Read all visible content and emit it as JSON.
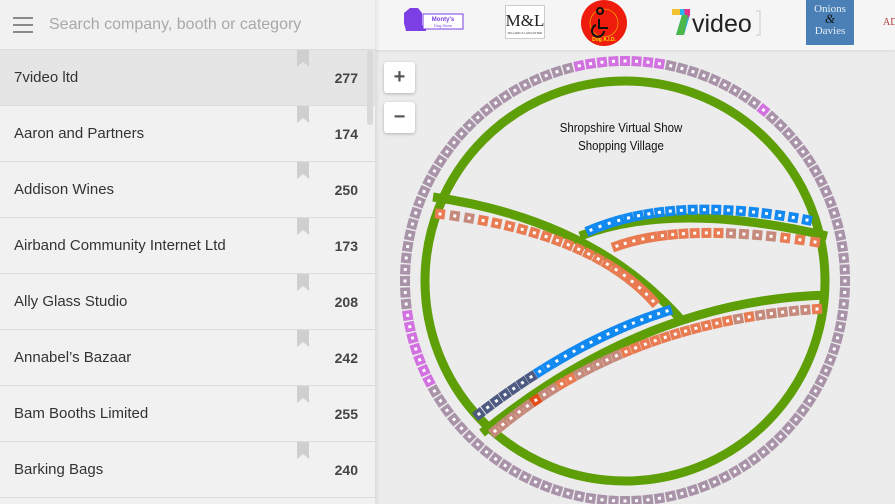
{
  "search": {
    "placeholder": "Search company, booth or category",
    "value": ""
  },
  "exhibitors": [
    {
      "name": "7video ltd",
      "booth": "277",
      "active": true
    },
    {
      "name": "Aaron and Partners",
      "booth": "174"
    },
    {
      "name": "Addison Wines",
      "booth": "250"
    },
    {
      "name": "Airband Community Internet Ltd",
      "booth": "173"
    },
    {
      "name": "Ally Glass Studio",
      "booth": "208"
    },
    {
      "name": "Annabel’s Bazaar",
      "booth": "242"
    },
    {
      "name": "Bam Booths Limited",
      "booth": "255"
    },
    {
      "name": "Barking Bags",
      "booth": "240"
    }
  ],
  "sponsors": [
    {
      "name": "Monty's Dog Store",
      "line1": "Monty's",
      "line2": "Dog Store"
    },
    {
      "name": "Millard & Lancaster",
      "line1": "M&L",
      "line2": "MILLARD & LANCASTER"
    },
    {
      "name": "Assistance In Disability Dog A.I.D.",
      "line1": "Assistance In Disability",
      "line2": "Dog A.I.D."
    },
    {
      "name": "7video",
      "line1": "7",
      "line2": "video"
    },
    {
      "name": "Onions & Davies",
      "line1": "Onions",
      "line2": "&",
      "line3": "Davies"
    },
    {
      "name": "AD",
      "line1": "AD"
    }
  ],
  "map": {
    "title_line1": "Shropshire Virtual Show",
    "title_line2": "Shopping Village",
    "zoom_in_label": "+",
    "zoom_out_label": "−",
    "colors": {
      "path": "#5e9e07",
      "booth_default": "#a993a9",
      "booth_featured": "#d272e0",
      "booth_food": "#e87b52",
      "booth_craft": "#c58a7c",
      "booth_blue": "#1289f0",
      "booth_navy": "#4f5a82",
      "booth_red": "#e24e1b"
    }
  }
}
